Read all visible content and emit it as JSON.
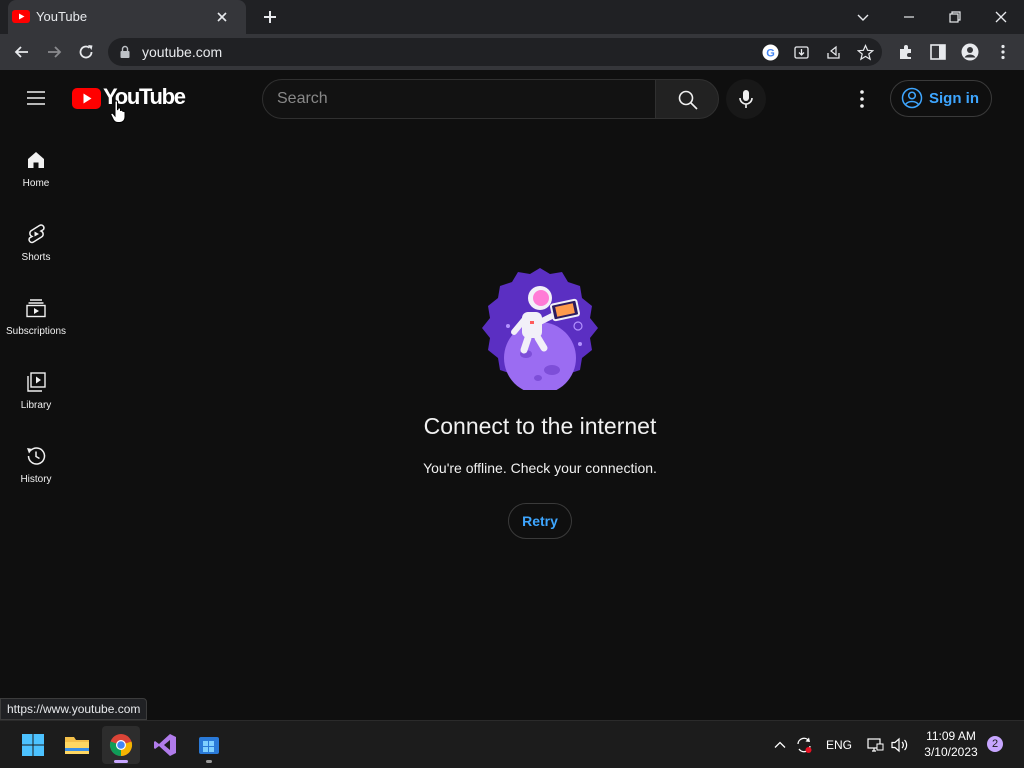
{
  "browser": {
    "tab_title": "YouTube",
    "url": "youtube.com",
    "status_url": "https://www.youtube.com"
  },
  "youtube": {
    "logo_text": "YouTube",
    "search": {
      "placeholder": "Search"
    },
    "signin_label": "Sign in",
    "sidebar": {
      "items": [
        {
          "label": "Home",
          "icon": "home-icon"
        },
        {
          "label": "Shorts",
          "icon": "shorts-icon"
        },
        {
          "label": "Subscriptions",
          "icon": "subscriptions-icon"
        },
        {
          "label": "Library",
          "icon": "library-icon"
        },
        {
          "label": "History",
          "icon": "history-icon"
        }
      ]
    },
    "offline": {
      "title": "Connect to the internet",
      "message": "You're offline. Check your connection.",
      "retry_label": "Retry"
    }
  },
  "taskbar": {
    "language": "ENG",
    "time": "11:09 AM",
    "date": "3/10/2023",
    "notification_count": "2"
  },
  "colors": {
    "accent_blue": "#3ea6ff",
    "youtube_red": "#ff0000",
    "background": "#0f0f0f"
  }
}
